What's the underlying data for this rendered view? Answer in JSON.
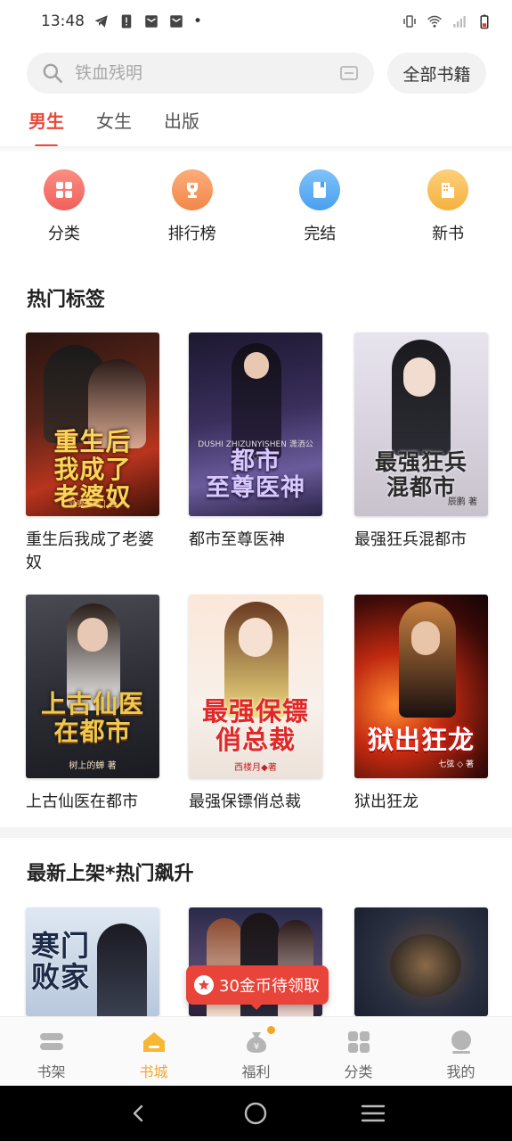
{
  "status_bar": {
    "time": "13:48",
    "dot": "•"
  },
  "search": {
    "placeholder": "铁血残明",
    "all_books_label": "全部书籍"
  },
  "tabs": [
    {
      "label": "男生",
      "active": true
    },
    {
      "label": "女生",
      "active": false
    },
    {
      "label": "出版",
      "active": false
    }
  ],
  "quick_entries": [
    {
      "label": "分类",
      "icon": "grid-icon",
      "color": "#f4736a"
    },
    {
      "label": "排行榜",
      "icon": "trophy-icon",
      "color": "#f59a5b"
    },
    {
      "label": "完结",
      "icon": "book-icon",
      "color": "#5aaef5"
    },
    {
      "label": "新书",
      "icon": "building-icon",
      "color": "#f5c04f"
    }
  ],
  "hot_tags": {
    "title": "热门标签",
    "books": [
      {
        "title": "重生后我成了老婆奴",
        "cover_text": "重生后\n我成了\n老婆奴",
        "cover_sub": "领妻大师 | 著"
      },
      {
        "title": "都市至尊医神",
        "cover_text": "都市\n至尊医神",
        "cover_sub": "DUSHI ZHIZUNYISHEN  潇洒公子 ◇ 著"
      },
      {
        "title": "最强狂兵混都市",
        "cover_text": "最强狂兵\n混都市",
        "cover_sub": "辰鹏 著"
      },
      {
        "title": "上古仙医在都市",
        "cover_text": "上古仙医\n在都市",
        "cover_sub": "树上的蝉 著"
      },
      {
        "title": "最强保镖俏总裁",
        "cover_text": "最强保镖\n俏总裁",
        "cover_sub": "西楼月◆著"
      },
      {
        "title": "狱出狂龙",
        "cover_text": "狱出狂龙",
        "cover_sub": "七弦 ◇ 著"
      }
    ]
  },
  "new_arrivals": {
    "title": "最新上架*热门飙升",
    "books": [
      {
        "cover_text": "寒门\n败家"
      },
      {
        "cover_text": ""
      },
      {
        "cover_text": ""
      }
    ]
  },
  "coin_pill": {
    "label": "30金币待领取"
  },
  "bottom_nav": [
    {
      "label": "书架",
      "icon": "bookshelf-icon",
      "active": false
    },
    {
      "label": "书城",
      "icon": "bookstore-icon",
      "active": true
    },
    {
      "label": "福利",
      "icon": "money-bag-icon",
      "active": false
    },
    {
      "label": "分类",
      "icon": "category-icon",
      "active": false
    },
    {
      "label": "我的",
      "icon": "profile-icon",
      "active": false
    }
  ],
  "colors": {
    "accent": "#e64a3b",
    "nav_active": "#f2a72e",
    "coin_pill": "#e8443a"
  }
}
